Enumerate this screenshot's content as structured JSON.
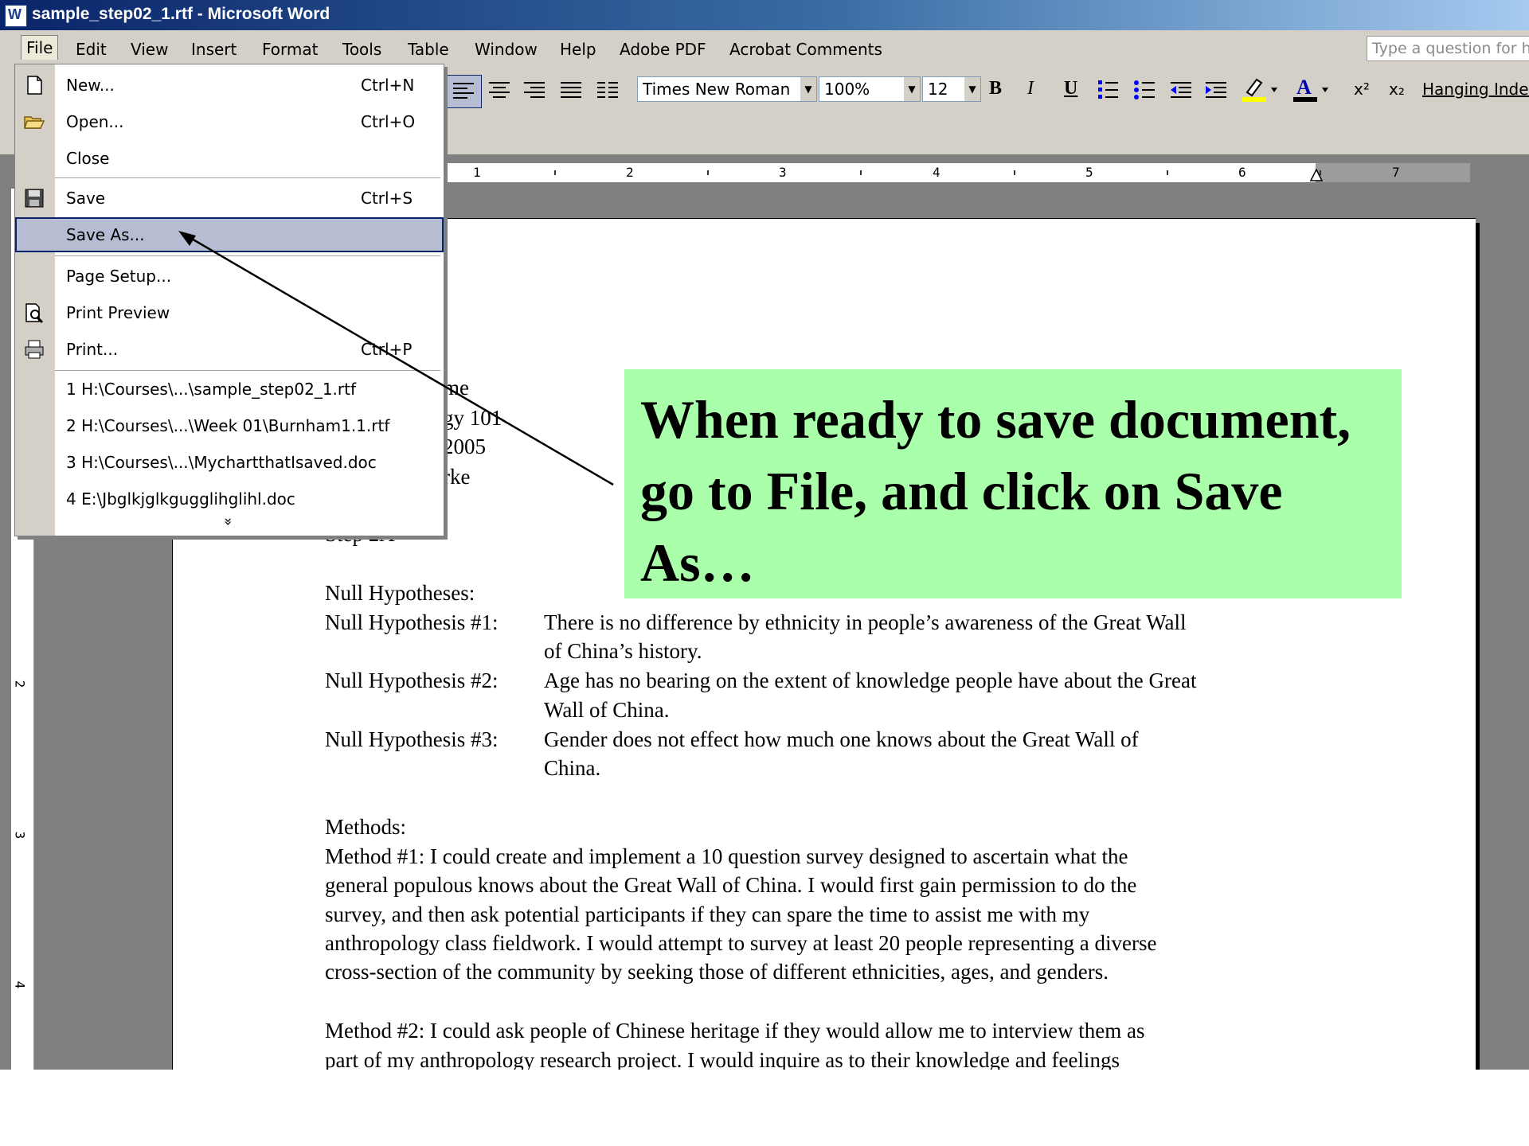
{
  "window": {
    "title": "sample_step02_1.rtf - Microsoft Word"
  },
  "menubar": {
    "items": [
      "File",
      "Edit",
      "View",
      "Insert",
      "Format",
      "Tools",
      "Table",
      "Window",
      "Help",
      "Adobe PDF",
      "Acrobat Comments"
    ],
    "ask_placeholder": "Type a question for h"
  },
  "toolbar": {
    "font": "Times New Roman",
    "zoom": "100%",
    "size": "12",
    "bold": "B",
    "italic": "I",
    "underline": "U",
    "superscript": "x²",
    "subscript": "x₂",
    "hanging": "Hanging Inden"
  },
  "ruler": {
    "numbers": [
      "1",
      "2",
      "3",
      "4",
      "5",
      "6",
      "7"
    ],
    "left_numbers": [
      "2",
      "3",
      "4"
    ]
  },
  "file_menu": {
    "items": [
      {
        "label": "New...",
        "shortcut": "Ctrl+N",
        "icon": "new-document-icon"
      },
      {
        "label": "Open...",
        "shortcut": "Ctrl+O",
        "icon": "open-folder-icon"
      },
      {
        "label": "Close",
        "shortcut": "",
        "icon": ""
      },
      {
        "label": "Save",
        "shortcut": "Ctrl+S",
        "icon": "save-disk-icon"
      },
      {
        "label": "Save As...",
        "shortcut": "",
        "icon": ""
      },
      {
        "label": "Page Setup...",
        "shortcut": "",
        "icon": ""
      },
      {
        "label": "Print Preview",
        "shortcut": "",
        "icon": "print-preview-icon"
      },
      {
        "label": "Print...",
        "shortcut": "Ctrl+P",
        "icon": "printer-icon"
      }
    ],
    "recent": [
      "1 H:\\Courses\\...\\sample_step02_1.rtf",
      "2 H:\\Courses\\...\\Week 01\\Burnham1.1.rtf",
      "3 H:\\Courses\\...\\MychartthatIsaved.doc",
      "4 E:\\Jbglkjglkgugglihglihl.doc"
    ],
    "expand": "»"
  },
  "document": {
    "partial_lines": [
      "me",
      "gy 101",
      "2005",
      "rke",
      "Step 2A"
    ],
    "null_heading": "Null Hypotheses:",
    "hypotheses": [
      {
        "label": "Null Hypothesis #1:",
        "line1": "There is no difference by ethnicity in people’s awareness of the Great Wall",
        "line2": "of China’s history."
      },
      {
        "label": "Null Hypothesis #2:",
        "line1": "Age has no bearing on the extent of knowledge people have about the Great",
        "line2": "Wall of China."
      },
      {
        "label": "Null Hypothesis #3:",
        "line1": "Gender does not effect how much one knows about the Great Wall of",
        "line2": "China."
      }
    ],
    "methods_heading": "Methods:",
    "method1": [
      "Method #1:  I could create and implement a 10 question survey designed to ascertain what the",
      "general populous knows about the Great Wall of China.  I would first gain permission to do the",
      "survey, and then ask potential participants if they can spare the time to assist me with my",
      "anthropology class fieldwork.  I would attempt to survey at least 20 people representing a diverse",
      "cross-section of the community by seeking those of different ethnicities, ages, and genders."
    ],
    "method2": [
      "Method #2:   I could ask people of Chinese heritage if they would allow me to interview them as",
      "part of my anthropology research project.  I would inquire as to their knowledge and feelings"
    ]
  },
  "callout": {
    "text": "When ready to save document, go to File, and click on Save As…"
  }
}
